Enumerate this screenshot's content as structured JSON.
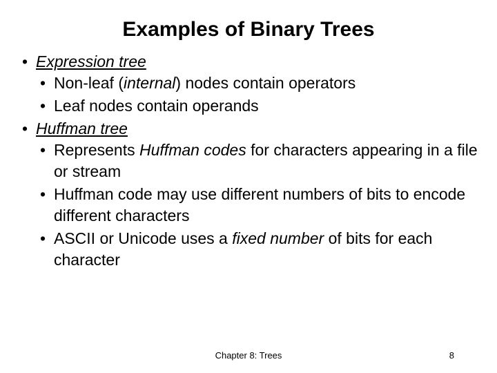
{
  "title": "Examples of Binary Trees",
  "b1": {
    "head": "Expression tree",
    "s1a": "Non-leaf (",
    "s1b": "internal",
    "s1c": ") nodes contain operators",
    "s2": "Leaf nodes contain operands"
  },
  "b2": {
    "head": "Huffman tree",
    "s1a": "Represents ",
    "s1b": "Huffman codes",
    "s1c": " for characters appearing in a file or stream",
    "s2": "Huffman code may use different numbers of bits to encode different characters",
    "s3a": "ASCII or Unicode uses a ",
    "s3b": "fixed number",
    "s3c": " of bits for each character"
  },
  "footer": {
    "chapter": "Chapter 8: Trees",
    "page": "8"
  }
}
